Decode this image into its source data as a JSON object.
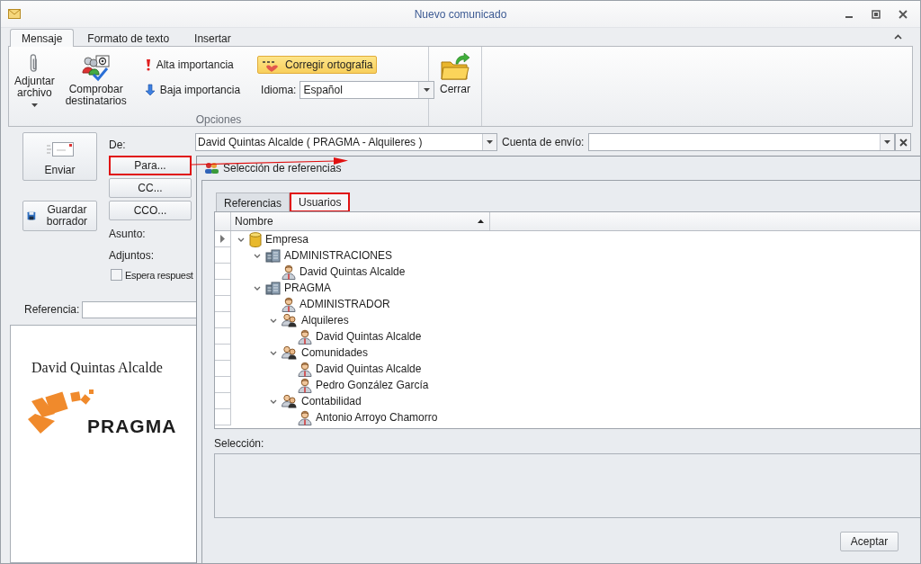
{
  "window": {
    "title": "Nuevo comunicado"
  },
  "ribbon": {
    "tabs": [
      {
        "label": "Mensaje",
        "selected": true
      },
      {
        "label": "Formato de texto",
        "selected": false
      },
      {
        "label": "Insertar",
        "selected": false
      }
    ],
    "attach_button": {
      "label": "Adjuntar archivo"
    },
    "check_recipients_button": {
      "label": "Comprobar destinatarios"
    },
    "high_importance_button": {
      "label": "Alta importancia"
    },
    "low_importance_button": {
      "label": "Baja importancia"
    },
    "spell_check_button": {
      "label": "Corregir ortografia",
      "on": true
    },
    "language": {
      "label": "Idioma:",
      "value": "Español"
    },
    "group_label": "Opciones",
    "close_button": {
      "label": "Cerrar"
    }
  },
  "compose": {
    "send_button": "Enviar",
    "save_draft_button": "Guardar borrador",
    "from_label": "De:",
    "from_value": "David Quintas Alcalde ( PRAGMA - Alquileres )",
    "account_label": "Cuenta de envío:",
    "recipient_buttons": [
      {
        "label": "Para...",
        "highlighted": true
      },
      {
        "label": "CC...",
        "highlighted": false
      },
      {
        "label": "CCO...",
        "highlighted": false
      }
    ],
    "subject_label": "Asunto:",
    "attachments_label": "Adjuntos:",
    "await_reply": {
      "label": "Espera respuest",
      "checked": false
    },
    "reference_label": "Referencia:",
    "body": {
      "signature_name": "David Quintas Alcalde",
      "logo_text": "PRAGMA"
    }
  },
  "dialog": {
    "title": "Selección de referencias",
    "tabs": [
      {
        "label": "Referencias",
        "selected": false,
        "highlighted": false
      },
      {
        "label": "Usuarios",
        "selected": true,
        "highlighted": true
      }
    ],
    "grid": {
      "column": "Nombre",
      "tree": [
        {
          "label": "Empresa",
          "kind": "database",
          "current": true,
          "expanded": true,
          "children": [
            {
              "label": "ADMINISTRACIONES",
              "kind": "company",
              "current": false,
              "expanded": true,
              "children": [
                {
                  "label": "David Quintas Alcalde",
                  "kind": "user",
                  "current": false
                }
              ]
            },
            {
              "label": "PRAGMA",
              "kind": "company",
              "current": false,
              "expanded": true,
              "children": [
                {
                  "label": "ADMINISTRADOR",
                  "kind": "user",
                  "current": false
                },
                {
                  "label": "Alquileres",
                  "kind": "group",
                  "current": false,
                  "expanded": true,
                  "children": [
                    {
                      "label": "David Quintas Alcalde",
                      "kind": "user",
                      "current": false
                    }
                  ]
                },
                {
                  "label": "Comunidades",
                  "kind": "group",
                  "current": false,
                  "expanded": true,
                  "children": [
                    {
                      "label": "David Quintas Alcalde",
                      "kind": "user",
                      "current": false
                    },
                    {
                      "label": "Pedro González García",
                      "kind": "user",
                      "current": false
                    }
                  ]
                },
                {
                  "label": "Contabilidad",
                  "kind": "group",
                  "current": false,
                  "expanded": true,
                  "children": [
                    {
                      "label": "Antonio Arroyo Chamorro",
                      "kind": "user",
                      "current": false
                    }
                  ]
                }
              ]
            }
          ]
        }
      ]
    },
    "selection_label": "Selección:",
    "ok_button": "Aceptar"
  }
}
